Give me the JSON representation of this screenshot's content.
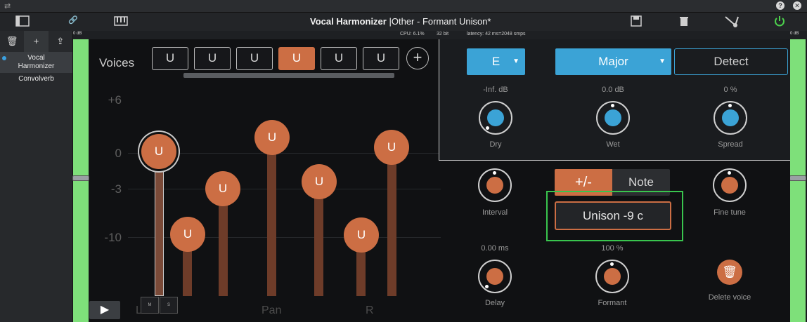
{
  "window": {
    "plugin_name": "Vocal Harmonizer",
    "preset": "Other - Formant Unison*",
    "separator": "|"
  },
  "status": {
    "db_left": "0 dB",
    "db_right": "0 dB",
    "cpu": "CPU: 6.1%",
    "bits": "32 bit",
    "latency": "latency: 42 ms=2048 smps"
  },
  "sidebar": {
    "tools": [
      "🗑",
      "+",
      "⇪"
    ],
    "plugins": [
      {
        "name": "Vocal Harmonizer",
        "selected": true
      },
      {
        "name": "Convolverb",
        "selected": false
      }
    ]
  },
  "voices": {
    "label": "Voices",
    "tabs": [
      "U",
      "U",
      "U",
      "U",
      "U",
      "U"
    ],
    "active_tab": 3,
    "add": "+",
    "axis": [
      "+6",
      "0",
      "-3",
      "-10"
    ],
    "knob_label": "U",
    "pan_labels": [
      "L",
      "Pan",
      "R"
    ],
    "ms": [
      "M",
      "S"
    ]
  },
  "key": {
    "note": "E",
    "scale": "Major",
    "detect": "Detect"
  },
  "params": {
    "dry": {
      "label": "Dry",
      "value": "-Inf. dB"
    },
    "wet": {
      "label": "Wet",
      "value": "0.0 dB"
    },
    "spread": {
      "label": "Spread",
      "value": "0 %"
    },
    "interval": {
      "label": "Interval"
    },
    "fine_tune": {
      "label": "Fine tune"
    },
    "delay": {
      "label": "Delay",
      "value": "0.00 ms"
    },
    "formant": {
      "label": "Formant",
      "value": "100 %"
    }
  },
  "interval": {
    "mode_plusminus": "+/-",
    "mode_note": "Note",
    "value": "Unison -9 c"
  },
  "delete_voice": "Delete voice",
  "colors": {
    "accent_orange": "#cc6e44",
    "accent_blue": "#3ba3d6",
    "meter_green": "#7ee07a",
    "highlight_green": "#39c54e"
  }
}
